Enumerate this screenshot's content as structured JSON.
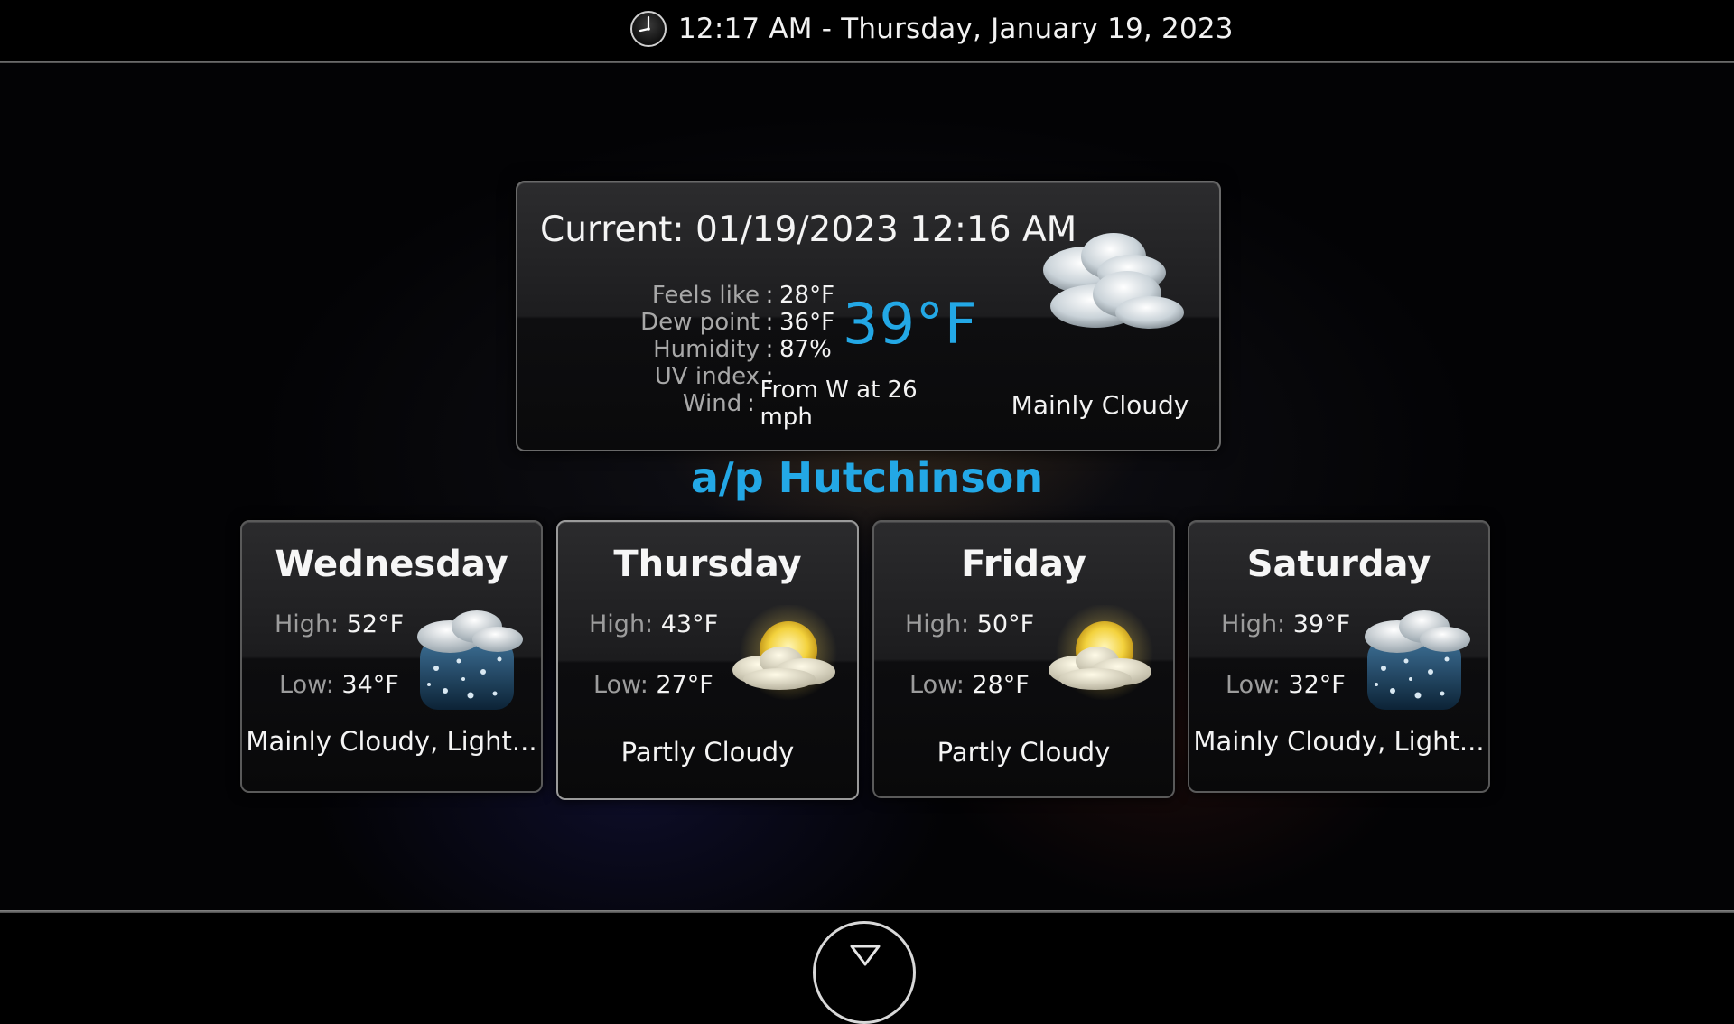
{
  "header": {
    "datetime": "12:17 AM - Thursday, January 19, 2023",
    "clock_icon": "clock-icon"
  },
  "current": {
    "title": "Current: 01/19/2023 12:16 AM",
    "temperature": "39°F",
    "condition": "Mainly Cloudy",
    "icon": "cloudy-icon",
    "stats": [
      {
        "label": "Feels like",
        "value": "28°F"
      },
      {
        "label": "Dew point",
        "value": "36°F"
      },
      {
        "label": "Humidity",
        "value": "87%"
      },
      {
        "label": "UV index",
        "value": ""
      },
      {
        "label": "Wind",
        "value": "From W at 26 mph"
      }
    ],
    "separator": ":"
  },
  "location": "a/p Hutchinson",
  "forecast": [
    {
      "day": "Wednesday",
      "high_label": "High:",
      "high": "52°F",
      "low_label": "Low:",
      "low": "34°F",
      "condition": "Mainly Cloudy, Light...",
      "icon": "snow-cloud-icon"
    },
    {
      "day": "Thursday",
      "high_label": "High:",
      "high": "43°F",
      "low_label": "Low:",
      "low": "27°F",
      "condition": "Partly Cloudy",
      "icon": "partly-cloudy-icon"
    },
    {
      "day": "Friday",
      "high_label": "High:",
      "high": "50°F",
      "low_label": "Low:",
      "low": "28°F",
      "condition": "Partly Cloudy",
      "icon": "partly-cloudy-icon"
    },
    {
      "day": "Saturday",
      "high_label": "High:",
      "high": "39°F",
      "low_label": "Low:",
      "low": "32°F",
      "condition": "Mainly Cloudy, Light...",
      "icon": "snow-cloud-icon"
    }
  ],
  "footer": {
    "down_icon": "chevron-down-icon"
  },
  "colors": {
    "accent": "#23a8e6",
    "background": "#000000",
    "border": "#6a6a6a"
  }
}
